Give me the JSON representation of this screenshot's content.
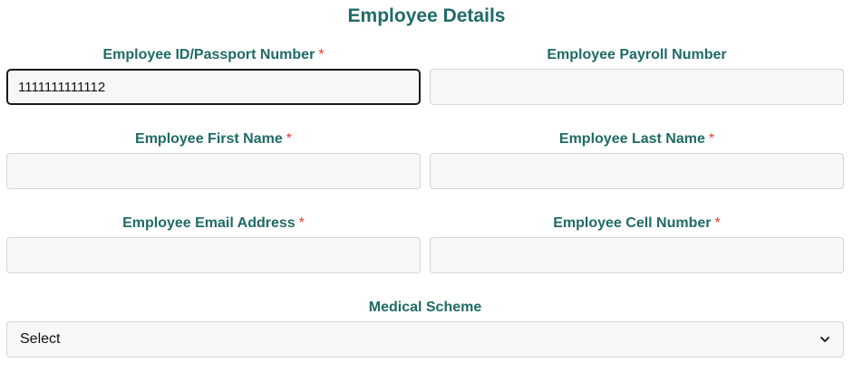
{
  "form": {
    "title": "Employee Details",
    "required_marker": "*",
    "fields": {
      "employee_id": {
        "label": "Employee ID/Passport Number",
        "value": "1111111111112",
        "placeholder": "",
        "required": true
      },
      "payroll_number": {
        "label": "Employee Payroll Number",
        "value": "",
        "placeholder": "",
        "required": false
      },
      "first_name": {
        "label": "Employee First Name",
        "value": "",
        "placeholder": "",
        "required": true
      },
      "last_name": {
        "label": "Employee Last Name",
        "value": "",
        "placeholder": "",
        "required": true
      },
      "email": {
        "label": "Employee Email Address",
        "value": "",
        "placeholder": "",
        "required": true
      },
      "cell_number": {
        "label": "Employee Cell Number",
        "value": "",
        "placeholder": "",
        "required": true
      },
      "medical_scheme": {
        "label": "Medical Scheme",
        "selected": "Select",
        "required": false
      }
    }
  },
  "colors": {
    "label": "#1f6b66",
    "required": "#e23b3b",
    "input_bg": "#f7f7f7",
    "input_border": "#d6d6d6",
    "focus_border": "#1a1a1a"
  }
}
